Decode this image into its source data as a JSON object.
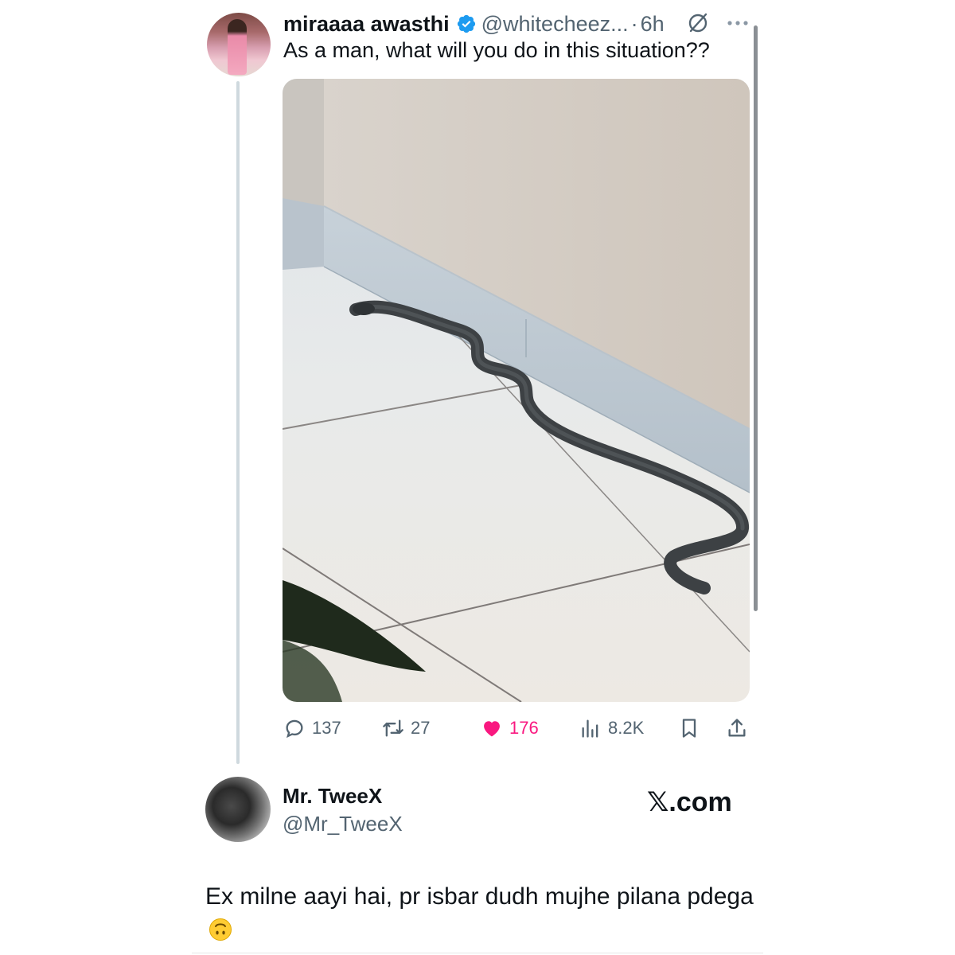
{
  "tweet": {
    "author_name": "miraaaa awasthi",
    "handle": "@whitecheez...",
    "separator": "·",
    "time": "6h",
    "text": "As a man, what will you do in this situation??",
    "stats": {
      "replies": "137",
      "reposts": "27",
      "likes": "176",
      "views": "8.2K"
    },
    "like_color": "#f91880",
    "verified_color": "#1d9bf0"
  },
  "reply": {
    "author_name": "Mr. TweeX",
    "handle": "@Mr_TweeX",
    "brand": "𝕏.com",
    "text": "Ex milne aayi hai, pr isbar dudh mujhe pilana pdega",
    "emoji": "upside-down-face"
  },
  "icons": [
    "verified-badge-icon",
    "grok-icon",
    "more-icon",
    "reply-icon",
    "repost-icon",
    "like-icon",
    "views-icon",
    "bookmark-icon",
    "share-icon",
    "upside-down-face-icon"
  ]
}
